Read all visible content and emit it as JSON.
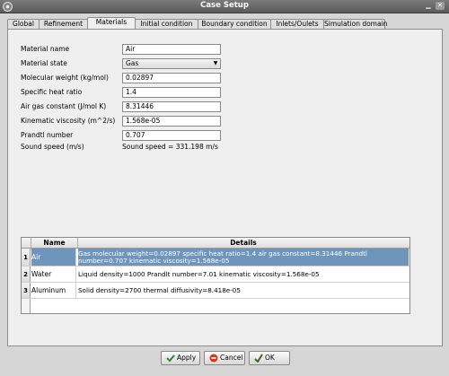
{
  "window": {
    "title": "Case Setup"
  },
  "tabs": [
    {
      "label": "Global"
    },
    {
      "label": "Refinement"
    },
    {
      "label": "Materials"
    },
    {
      "label": "Initial condition"
    },
    {
      "label": "Boundary condition"
    },
    {
      "label": "Inlets/Oulets"
    },
    {
      "label": "Simulation domain"
    }
  ],
  "active_tab": "Materials",
  "form": {
    "material_name": {
      "label": "Material name",
      "value": "Air"
    },
    "material_state": {
      "label": "Material state",
      "value": "Gas"
    },
    "molecular_weight": {
      "label": "Molecular weight (kg/mol)",
      "value": "0.02897"
    },
    "specific_heat_ratio": {
      "label": "Specific heat ratio",
      "value": "1.4"
    },
    "air_gas_constant": {
      "label": "Air gas constant (J/mol K)",
      "value": "8.31446"
    },
    "kinematic_viscosity": {
      "label": "Kinematic viscosity (m^2/s)",
      "value": "1.568e-05"
    },
    "prandtl_number": {
      "label": "Prandtl number",
      "value": "0.707"
    },
    "sound_speed": {
      "label": "Sound speed (m/s)",
      "value": "Sound speed = 331.198 m/s"
    }
  },
  "table": {
    "headers": [
      "Name",
      "Details"
    ],
    "rows": [
      {
        "num": "1",
        "name": "Air",
        "details": "Gas molecular weight=0.02897 specific heat ratio=1.4 air gas constant=8.31446 Prandtl number=0.707 kinematic viscosity=1.568e-05"
      },
      {
        "num": "2",
        "name": "Water",
        "details": "Liquid density=1000 Prandlt number=7.01 kinematic viscosity=1.568e-05"
      },
      {
        "num": "3",
        "name": "Aluminum",
        "details": "Solid density=2700 thermal diffusivity=8.418e-05"
      }
    ]
  },
  "buttons": {
    "apply": "Apply",
    "cancel": "Cancel",
    "ok": "OK"
  }
}
